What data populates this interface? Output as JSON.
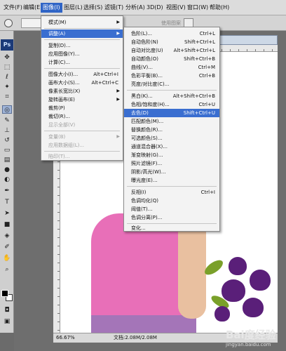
{
  "menubar": {
    "items": [
      "文件(F)",
      "编辑(E)",
      "图像(I)",
      "图层(L)",
      "选择(S)",
      "滤镜(T)",
      "分析(A)",
      "3D(D)",
      "视图(V)",
      "窗口(W)",
      "帮助(H)"
    ]
  },
  "optbar": {
    "label": "使用图案"
  },
  "image_menu": {
    "items": [
      {
        "label": "模式(M)",
        "shortcut": ""
      },
      {
        "label": "调整(A)",
        "shortcut": ""
      },
      {
        "label": "复制(D)...",
        "shortcut": ""
      },
      {
        "label": "应用图像(Y)...",
        "shortcut": ""
      },
      {
        "label": "计算(C)...",
        "shortcut": ""
      },
      {
        "label": "图像大小(I)...",
        "shortcut": "Alt+Ctrl+I"
      },
      {
        "label": "画布大小(S)...",
        "shortcut": "Alt+Ctrl+C"
      },
      {
        "label": "像素长宽比(X)",
        "shortcut": ""
      },
      {
        "label": "旋转画布(E)",
        "shortcut": ""
      },
      {
        "label": "裁剪(P)",
        "shortcut": ""
      },
      {
        "label": "裁切(R)...",
        "shortcut": ""
      },
      {
        "label": "显示全部(V)",
        "shortcut": ""
      },
      {
        "label": "变量(B)",
        "shortcut": ""
      },
      {
        "label": "应用数据组(L)...",
        "shortcut": ""
      },
      {
        "label": "陷印(T)...",
        "shortcut": ""
      }
    ]
  },
  "adjust_menu": {
    "items": [
      {
        "label": "色阶(L)...",
        "shortcut": "Ctrl+L"
      },
      {
        "label": "自动色阶(N)",
        "shortcut": "Shift+Ctrl+L"
      },
      {
        "label": "自动对比度(U)",
        "shortcut": "Alt+Shift+Ctrl+L"
      },
      {
        "label": "自动颜色(O)",
        "shortcut": "Shift+Ctrl+B"
      },
      {
        "label": "曲线(V)...",
        "shortcut": "Ctrl+M"
      },
      {
        "label": "色彩平衡(B)...",
        "shortcut": "Ctrl+B"
      },
      {
        "label": "亮度/对比度(C)...",
        "shortcut": ""
      },
      {
        "label": "黑白(K)...",
        "shortcut": "Alt+Shift+Ctrl+B"
      },
      {
        "label": "色相/饱和度(H)...",
        "shortcut": "Ctrl+U"
      },
      {
        "label": "去色(D)",
        "shortcut": "Shift+Ctrl+U"
      },
      {
        "label": "匹配颜色(M)...",
        "shortcut": ""
      },
      {
        "label": "替换颜色(R)...",
        "shortcut": ""
      },
      {
        "label": "可选颜色(S)...",
        "shortcut": ""
      },
      {
        "label": "通道混合器(X)...",
        "shortcut": ""
      },
      {
        "label": "渐变映射(G)...",
        "shortcut": ""
      },
      {
        "label": "照片滤镜(F)...",
        "shortcut": ""
      },
      {
        "label": "阴影/高光(W)...",
        "shortcut": ""
      },
      {
        "label": "曝光度(E)...",
        "shortcut": ""
      },
      {
        "label": "反相(I)",
        "shortcut": "Ctrl+I"
      },
      {
        "label": "色调均化(Q)",
        "shortcut": ""
      },
      {
        "label": "阈值(T)...",
        "shortcut": ""
      },
      {
        "label": "色调分离(P)...",
        "shortcut": ""
      },
      {
        "label": "变化...",
        "shortcut": ""
      }
    ]
  },
  "status": {
    "zoom": "66.67%",
    "doc_size": "文档:2.08M/2.08M"
  },
  "tools": {
    "ps_logo": "Ps"
  },
  "watermark": {
    "logo": "Bai度经验",
    "url": "jingyan.baidu.com"
  },
  "colors": {
    "highlight": "#3a6ed0",
    "menu_active": "#2f64c6"
  }
}
